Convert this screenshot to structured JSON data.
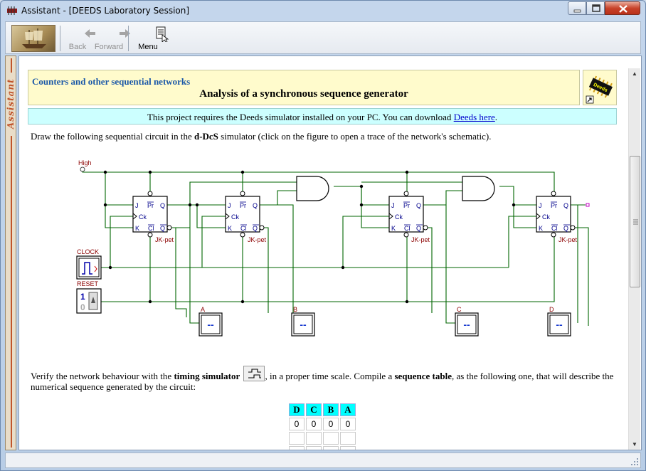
{
  "window": {
    "title": "Assistant - [DEEDS Laboratory Session]"
  },
  "toolbar": {
    "back_label": "Back",
    "forward_label": "Forward",
    "menu_label": "Menu"
  },
  "sidepanel": {
    "label": "Assistant"
  },
  "header": {
    "category": "Counters and other sequential networks",
    "title": "Analysis of a synchronous sequence generator"
  },
  "notice": {
    "text": "This project requires the Deeds simulator installed on your PC. You can download ",
    "link": "Deeds here",
    "end": "."
  },
  "intro": {
    "pre": "Draw the following sequential circuit in the ",
    "bold": "d-DcS",
    "post": " simulator (click on the figure to open a trace of the network's schematic)."
  },
  "schematic": {
    "high_label": "High",
    "clock_label": "CLOCK",
    "reset_label": "RESET",
    "reset_one": "1",
    "reset_zero": "0",
    "ff_pins": {
      "j": "J",
      "pr": "Pr",
      "q": "Q",
      "ck": "Ck",
      "k": "K",
      "cl": "Cl",
      "qn": "Q"
    },
    "ff_name": "JK-pet",
    "outputs": [
      "A",
      "B",
      "C",
      "D"
    ],
    "display_text": "--"
  },
  "verify": {
    "pre": "Verify the network behaviour with the ",
    "bold1": "timing simulator",
    "mid": ", in a proper time scale. Compile a ",
    "bold2": "sequence table",
    "post": ", as the following one, that will describe the numerical sequence generated by the circuit:"
  },
  "sequence_table": {
    "headers": [
      "D",
      "C",
      "B",
      "A"
    ],
    "rows": [
      [
        "0",
        "0",
        "0",
        "0"
      ],
      [
        "",
        "",
        "",
        ""
      ],
      [
        "",
        "",
        "",
        ""
      ],
      [
        "",
        "",
        "",
        ""
      ],
      [
        "",
        "",
        "",
        ""
      ]
    ]
  },
  "colors": {
    "wire": "#006600",
    "link": "#0000cc",
    "header_bg": "#fffbcc",
    "notice_bg": "#ccffff",
    "table_header": "#00ffff"
  }
}
